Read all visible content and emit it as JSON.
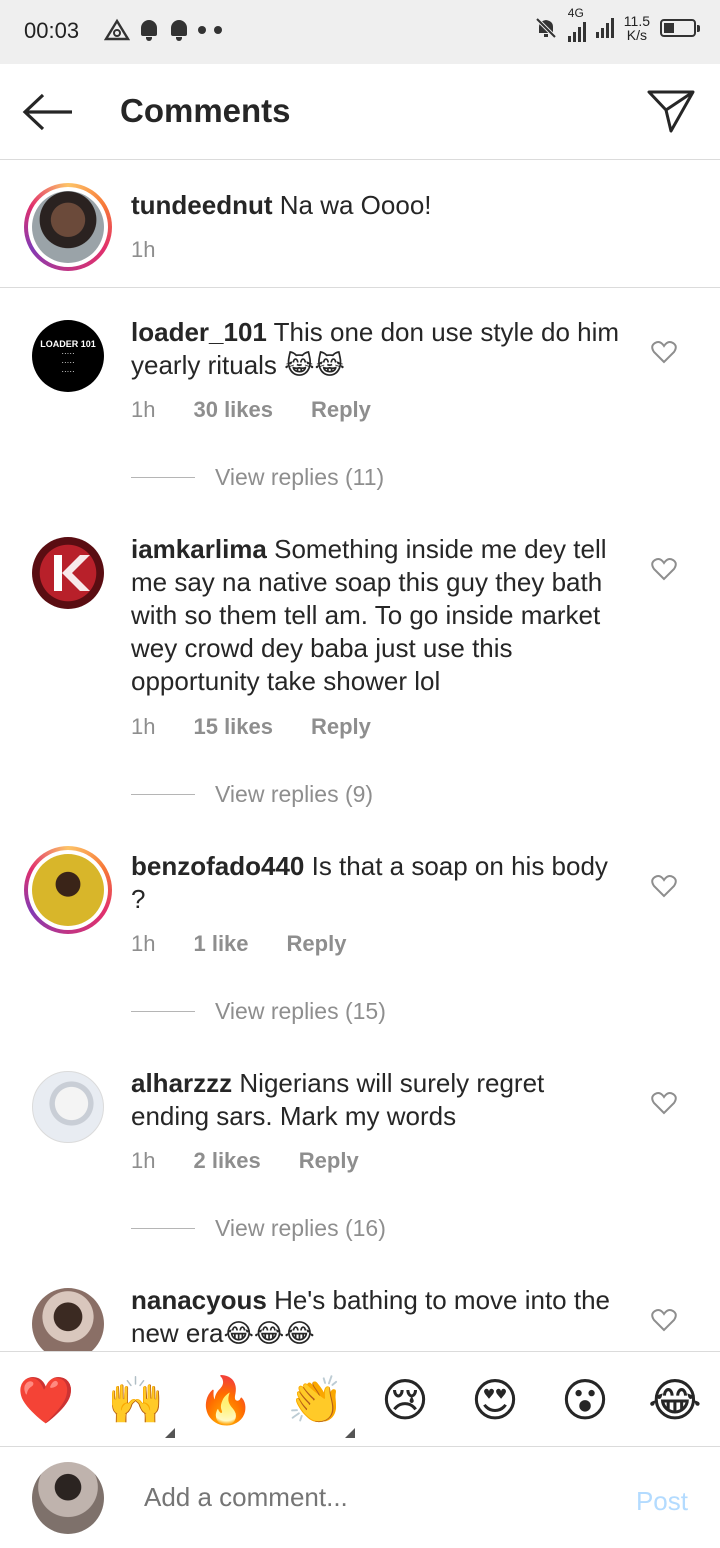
{
  "status_bar": {
    "time": "00:03",
    "network_type": "4G",
    "speed_value": "11.5",
    "speed_unit": "K/s"
  },
  "header": {
    "title": "Comments"
  },
  "caption": {
    "username": "tundeednut",
    "text": "Na wa Oooo!",
    "time": "1h"
  },
  "comments": [
    {
      "username": "loader_101",
      "text": "This one don use style do him yearly rituals 😹😹",
      "time": "1h",
      "likes": "30 likes",
      "reply": "Reply",
      "view_replies": "View replies (11)"
    },
    {
      "username": "iamkarlima",
      "text": "Something inside me dey tell me say na native soap this guy they bath with so them tell am. To go inside market wey crowd dey baba just use this opportunity take shower lol",
      "time": "1h",
      "likes": "15 likes",
      "reply": "Reply",
      "view_replies": "View replies (9)"
    },
    {
      "username": "benzofado440",
      "text": "Is that a soap on his body ?",
      "time": "1h",
      "likes": "1 like",
      "reply": "Reply",
      "view_replies": "View replies (15)"
    },
    {
      "username": "alharzzz",
      "text": "Nigerians will surely regret ending sars. Mark my words",
      "time": "1h",
      "likes": "2 likes",
      "reply": "Reply",
      "view_replies": "View replies (16)"
    },
    {
      "username": "nanacyous",
      "text": "He's bathing to move into the new era😂😂😂"
    }
  ],
  "reactions": [
    "❤️",
    "🙌",
    "🔥",
    "👏",
    "😢",
    "😍",
    "😮",
    "😂"
  ],
  "composer": {
    "placeholder": "Add a comment...",
    "post_label": "Post"
  },
  "colors": {
    "text": "#262626",
    "secondary": "#8e8e8e",
    "post_disabled": "#b3dbff",
    "divider": "#dbdbdb"
  }
}
